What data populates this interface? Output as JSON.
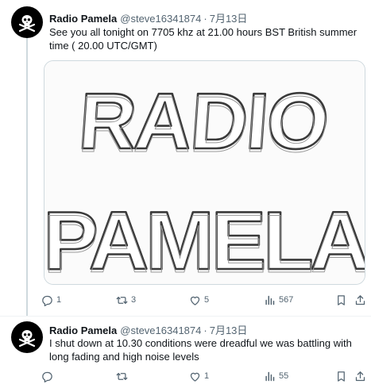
{
  "tweets": [
    {
      "author_name": "Radio Pamela",
      "handle": "@steve16341874",
      "separator": "·",
      "date": "7月13日",
      "text": "See you all tonight on 7705 khz at 21.00 hours BST British summer time ( 20.00 UTC/GMT)",
      "media": {
        "line1": "RADIO",
        "line2": "PAMELA"
      },
      "actions": {
        "replies": "1",
        "retweets": "3",
        "likes": "5",
        "views": "567"
      }
    },
    {
      "author_name": "Radio Pamela",
      "handle": "@steve16341874",
      "separator": "·",
      "date": "7月13日",
      "text": "I shut down at 10.30 conditions were dreadful  we was battling with long fading and high noise levels",
      "actions": {
        "replies": "",
        "retweets": "",
        "likes": "1",
        "views": "55"
      }
    }
  ],
  "icons": {
    "avatar": "skull-crossbones-icon",
    "reply": "reply-icon",
    "retweet": "retweet-icon",
    "like": "heart-icon",
    "views": "bar-chart-icon",
    "bookmark": "bookmark-icon",
    "share": "share-icon"
  },
  "colors": {
    "text": "#0f1419",
    "secondary": "#536471",
    "border": "#cfd9de"
  }
}
